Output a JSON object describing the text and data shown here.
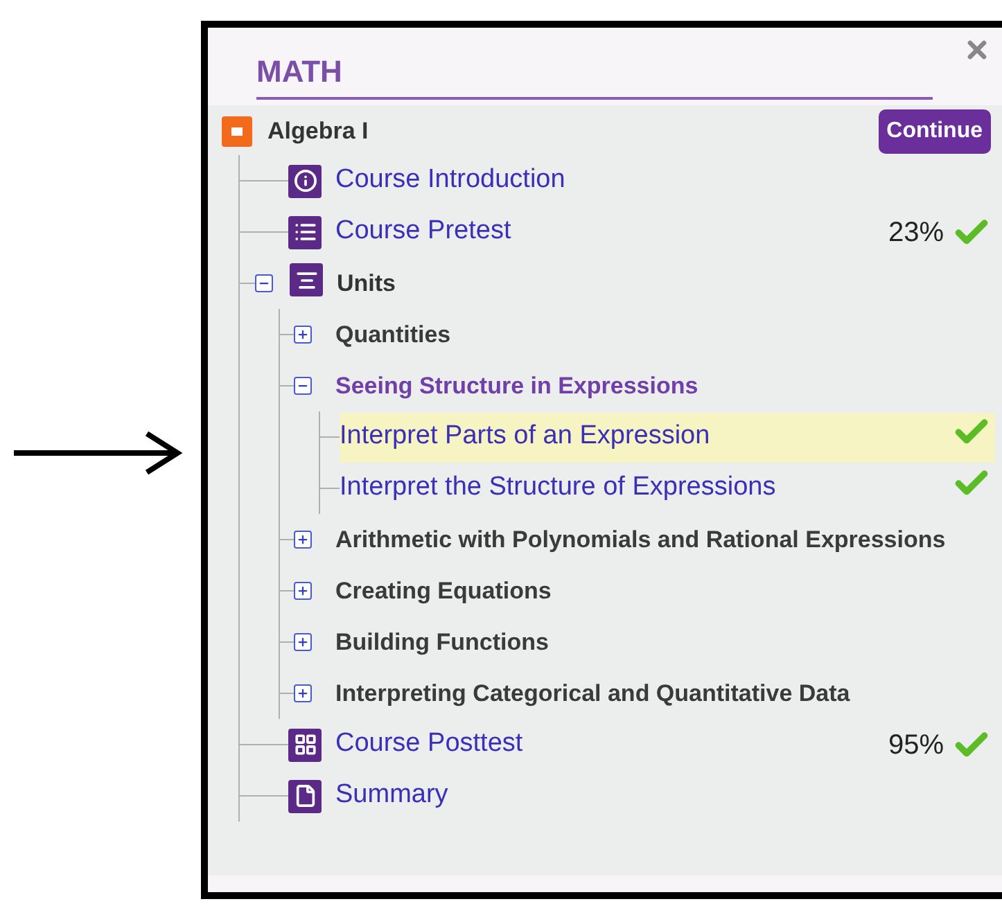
{
  "panel": {
    "title": "MATH"
  },
  "course": {
    "title": "Algebra I",
    "expanded": true,
    "action": "Continue",
    "items": [
      {
        "kind": "info",
        "label": "Course Introduction",
        "completed": false
      },
      {
        "kind": "test",
        "label": "Course Pretest",
        "score": "23%",
        "completed": true
      },
      {
        "kind": "units",
        "label": "Units",
        "expanded": true,
        "children": [
          {
            "label": "Quantities",
            "expanded": false,
            "active": false
          },
          {
            "label": "Seeing Structure in Expressions",
            "expanded": true,
            "active": true,
            "children": [
              {
                "label": "Interpret Parts of an Expression",
                "selected": true,
                "completed": true
              },
              {
                "label": "Interpret the Structure of Expressions",
                "selected": false,
                "completed": true
              }
            ]
          },
          {
            "label": "Arithmetic with Polynomials and Rational Expressions",
            "expanded": false,
            "active": false
          },
          {
            "label": "Creating Equations",
            "expanded": false,
            "active": false
          },
          {
            "label": "Building Functions",
            "expanded": false,
            "active": false
          },
          {
            "label": "Interpreting Categorical and Quantitative Data",
            "expanded": false,
            "active": false
          }
        ]
      },
      {
        "kind": "posttest",
        "label": "Course Posttest",
        "score": "95%",
        "completed": true
      },
      {
        "kind": "summary",
        "label": "Summary",
        "completed": false
      }
    ]
  }
}
